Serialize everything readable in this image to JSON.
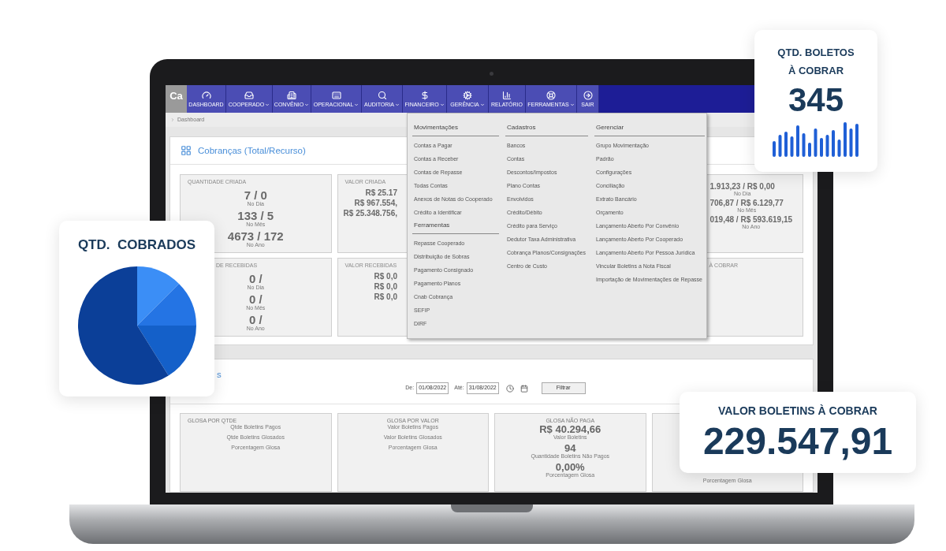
{
  "nav": {
    "logo": "Ca",
    "items": [
      {
        "label": "DASHBOARD",
        "has_menu": false
      },
      {
        "label": "COOPERADO",
        "has_menu": true
      },
      {
        "label": "CONVÊNIO",
        "has_menu": true
      },
      {
        "label": "OPERACIONAL",
        "has_menu": true
      },
      {
        "label": "AUDITORIA",
        "has_menu": true
      },
      {
        "label": "FINANCEIRO",
        "has_menu": true
      },
      {
        "label": "GERÊNCIA",
        "has_menu": true
      },
      {
        "label": "RELATÓRIO",
        "has_menu": false
      },
      {
        "label": "FERRAMENTAS",
        "has_menu": true
      },
      {
        "label": "SAIR",
        "has_menu": false
      }
    ]
  },
  "breadcrumb": "Dashboard",
  "panel1": {
    "title": "Cobranças (Total/Recurso)",
    "row1": [
      {
        "title": "QUANTIDADE CRIADA",
        "rows": [
          {
            "value": "7 / 0",
            "caption": "No Dia"
          },
          {
            "value": "133 / 5",
            "caption": "No Mês"
          },
          {
            "value": "4673 / 172",
            "caption": "No Ano"
          }
        ]
      },
      {
        "title": "VALOR CRIADA",
        "rows": [
          {
            "value": "R$ 25.17"
          },
          {
            "value": "R$ 967.554,"
          },
          {
            "value": "R$ 25.348.756,"
          }
        ]
      },
      {
        "rows": [
          {
            "value": "1.913,23 / R$ 0,00",
            "caption": "No Dia"
          },
          {
            "value": "706,87 / R$ 6.129,77",
            "caption": "No Mês"
          },
          {
            "value": "019,48 / R$ 593.619,15",
            "caption": "No Ano"
          }
        ]
      }
    ],
    "row2": [
      {
        "title": "DE RECEBIDAS",
        "rows": [
          {
            "value": "0 /",
            "caption": "No Dia"
          },
          {
            "value": "0 /",
            "caption": "No Mês"
          },
          {
            "value": "0 /",
            "caption": "No Ano"
          }
        ]
      },
      {
        "title": "VALOR RECEBIDAS",
        "rows": [
          {
            "value": "R$ 0,0"
          },
          {
            "value": "R$ 0,0"
          },
          {
            "value": "R$ 0,0"
          }
        ]
      },
      {
        "title": "À COBRAR"
      }
    ]
  },
  "dropdown": {
    "columns": [
      {
        "sections": [
          {
            "heading": "Movimentações",
            "items": [
              "Contas a Pagar",
              "Contas a Receber",
              "Contas de Repasse",
              "Todas Contas",
              "Anexos de Notas do Cooperado",
              "Crédito a Identificar"
            ]
          },
          {
            "heading": "Ferramentas",
            "items": [
              "Repasse Cooperado",
              "Distribuição de Sobras",
              "Pagamento Consignado",
              "Pagamento Planos",
              "Cnab Cobrança",
              "SEFIP",
              "DIRF"
            ]
          }
        ]
      },
      {
        "sections": [
          {
            "heading": "Cadastros",
            "items": [
              "Bancos",
              "Contas",
              "Descontos/Impostos",
              "Plano Contas",
              "Envolvidos",
              "Crédito/Débito",
              "Crédito para Serviço",
              "Dedutor Taxa Administrativa",
              "Cobrança Planos/Consignações",
              "Centro de Custo"
            ]
          }
        ]
      },
      {
        "sections": [
          {
            "heading": "Gerenciar",
            "items": [
              "Grupo Movimentação",
              "Padrão",
              "Configurações",
              "Conciliação",
              "Extrato Bancário",
              "Orçamento",
              "Lançamento Aberto Por Convênio",
              "Lançamento Aberto Por Cooperado",
              "Lançamento Aberto Por Pessoa Jurídica",
              "Vincular Boletins a Nota Fiscal",
              "Importação de Movimentações de Repasse"
            ]
          }
        ]
      }
    ]
  },
  "panel2": {
    "title": "s",
    "filter": {
      "from_label": "De:",
      "from": "01/08/2022",
      "to_label": "Até:",
      "to": "31/08/2022",
      "button": "Filtrar"
    },
    "cards": [
      {
        "title": "GLOSA POR QTDE",
        "rows": [
          {
            "caption": "Qtde Boletins Pagos"
          },
          {
            "caption": "Qtde Boletins Glosados"
          },
          {
            "caption": "Porcentagem Glosa"
          }
        ]
      },
      {
        "title": "GLOSA POR VALOR",
        "rows": [
          {
            "caption": "Valor Boletins Pagos"
          },
          {
            "caption": "Valor Boletins Glosados"
          },
          {
            "caption": "Porcentagem Glosa"
          }
        ]
      },
      {
        "title": "GLOSA NÃO PAGA",
        "rows": [
          {
            "value": "R$ 40.294,66",
            "caption": "Valor Boletins"
          },
          {
            "value": "94",
            "caption": "Quantidade Boletins Não Pagos"
          },
          {
            "value": "0,00%",
            "caption": "Porcentagem Glosa"
          }
        ]
      },
      {
        "rows": [
          {
            "caption": "Porcentagem Glosa"
          }
        ]
      }
    ]
  },
  "promo": {
    "boletos": {
      "title": "QTD. BOLETOS À COBRAR",
      "value": "345"
    },
    "cobrados": {
      "title": "QTD.  COBRADOS"
    },
    "valor": {
      "title": "VALOR BOLETINS À COBRAR",
      "value": "229.547,91"
    }
  }
}
